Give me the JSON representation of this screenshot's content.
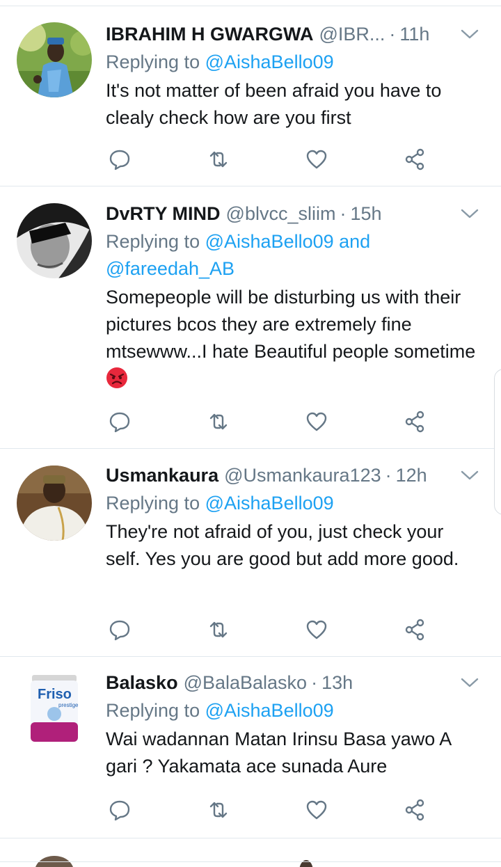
{
  "tweets": [
    {
      "name": "IBRAHIM H GWARGWA",
      "handle": "@IBR...",
      "separator": "·",
      "time": "11h",
      "replying_label": "Replying to",
      "mentions": "@AishaBello09",
      "mentions_line2": "",
      "text": "It's not matter of been afraid you have to clealy check how are you first",
      "avatar_icon": "man-in-blue-attire-avatar"
    },
    {
      "name": "DvRTY MIND",
      "handle": "@blvcc_sliim",
      "separator": "·",
      "time": "15h",
      "replying_label": "Replying to",
      "mentions": "@AishaBello09 and",
      "mentions_line2": "@fareedah_AB",
      "text": "Somepeople will be disturbing us with their pictures bcos they are extremely fine mtsewww...I hate Beautiful people sometime",
      "emoji": "angry-face-emoji",
      "avatar_icon": "man-with-sunglasses-avatar"
    },
    {
      "name": "Usmankaura",
      "handle": "@Usmankaura123",
      "separator": "·",
      "time": "12h",
      "replying_label": "Replying to",
      "mentions": "@AishaBello09",
      "mentions_line2": "",
      "text": "They're not afraid of you, just check your self. Yes you are good but add more good.",
      "avatar_icon": "man-in-white-robe-avatar"
    },
    {
      "name": "Balasko",
      "handle": "@BalaBalasko",
      "separator": "·",
      "time": "13h",
      "replying_label": "Replying to",
      "mentions": "@AishaBello09",
      "mentions_line2": "",
      "text": "Wai wadannan Matan Irinsu Basa yawo A gari ? Yakamata ace sunada Aure",
      "avatar_icon": "friso-milk-tin-avatar"
    }
  ],
  "avatar_labels": {
    "friso_brand": "Friso",
    "friso_sub": "prestige"
  },
  "actions": [
    "reply-icon",
    "retweet-icon",
    "like-icon",
    "share-icon"
  ],
  "colors": {
    "link": "#1da1f2",
    "muted": "#657786",
    "text": "#14171a",
    "divider": "#e1e8ed"
  }
}
